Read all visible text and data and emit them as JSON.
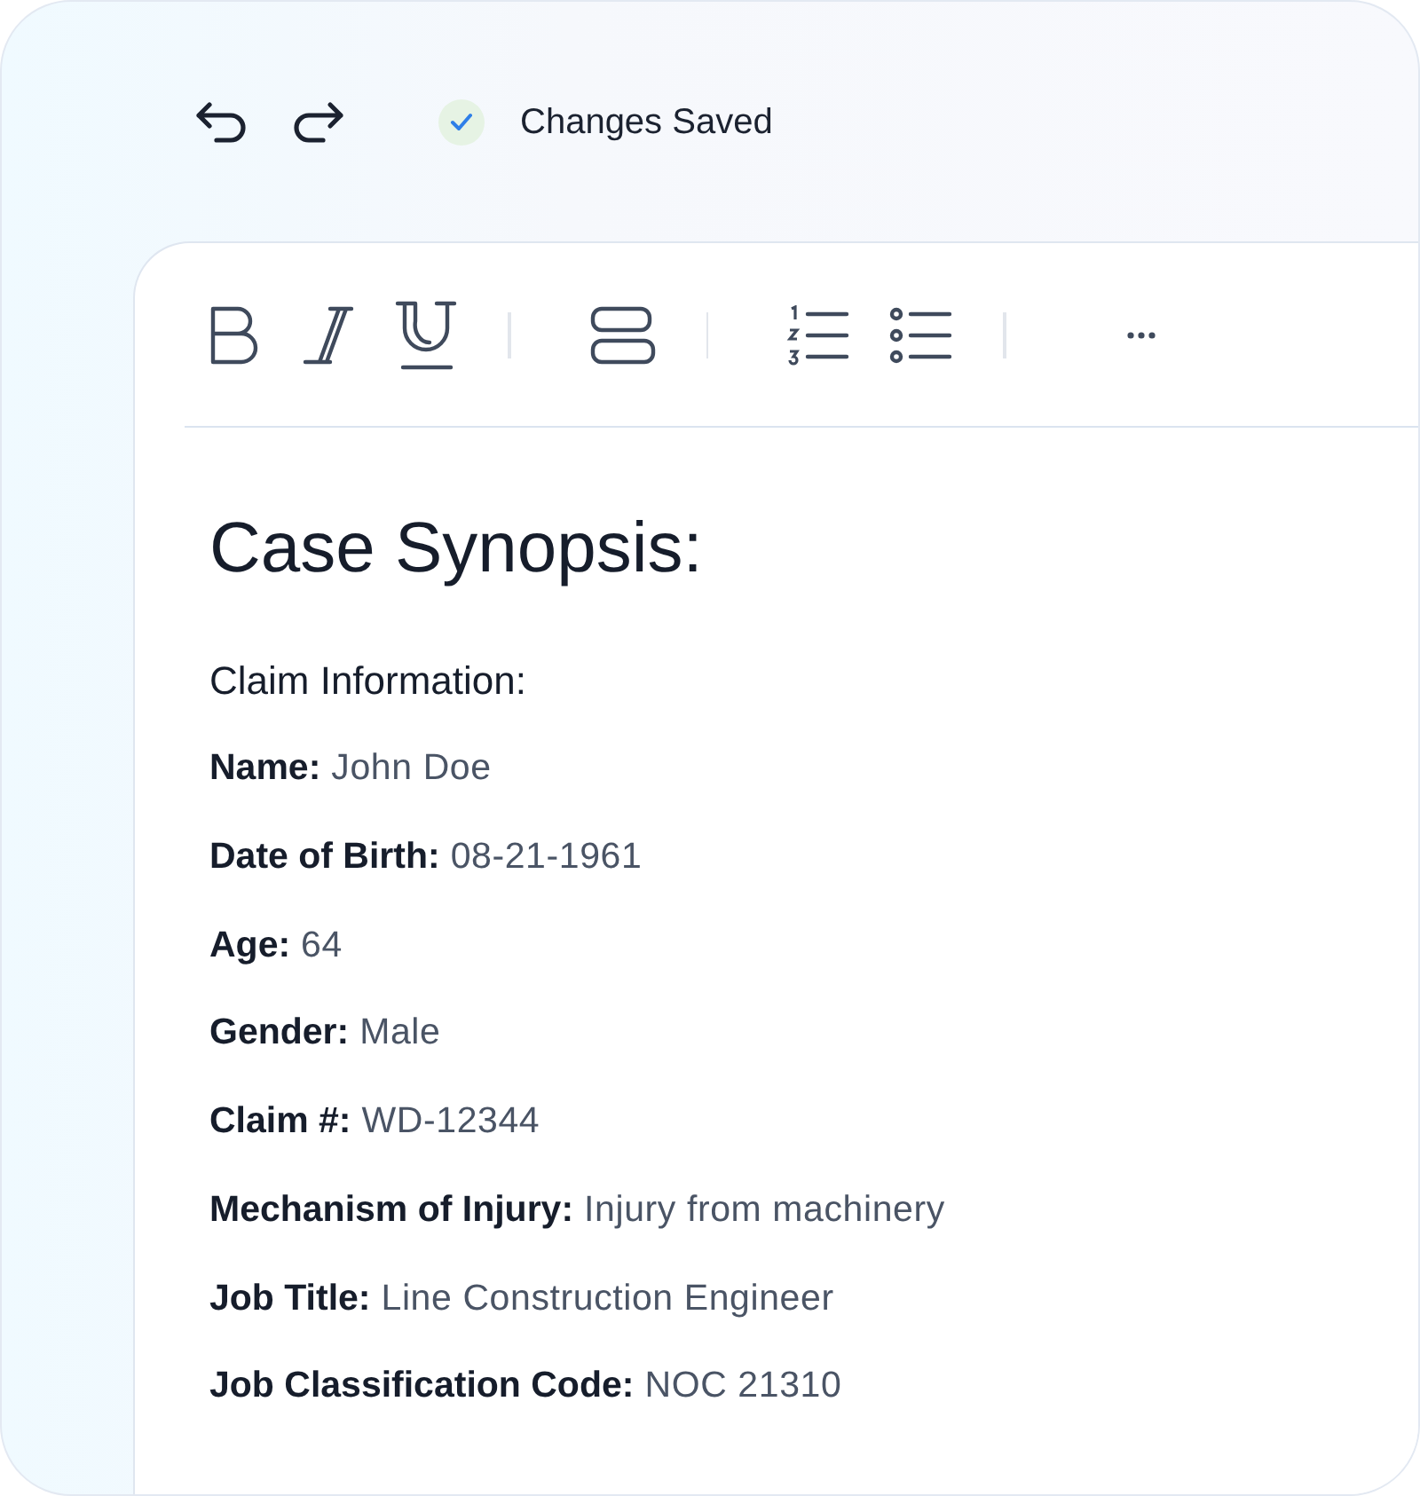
{
  "header": {
    "actions": [
      {
        "kind": "undo"
      },
      {
        "kind": "redo"
      }
    ],
    "status": {
      "saved": true,
      "text": "Changes Saved"
    }
  },
  "toolbar": [
    {
      "kind": "bold"
    },
    {
      "kind": "italic"
    },
    {
      "kind": "underline"
    },
    {
      "kind": "divider"
    },
    {
      "kind": "block"
    },
    {
      "kind": "divider"
    },
    {
      "kind": "ordered-list"
    },
    {
      "kind": "bullet-list"
    },
    {
      "kind": "divider"
    },
    {
      "kind": "more"
    }
  ],
  "document": {
    "title": "Case Synopsis:",
    "section": "Claim Information:",
    "fields": [
      {
        "label": "Name:",
        "value": "John Doe"
      },
      {
        "label": "Date of Birth:",
        "value": "08-21-1961"
      },
      {
        "label": "Age:",
        "value": "64"
      },
      {
        "label": "Gender:",
        "value": "Male"
      },
      {
        "label": "Claim #:",
        "value": "WD-12344"
      },
      {
        "label": "Mechanism of Injury:",
        "value": "Injury from machinery"
      },
      {
        "label": "Job Title:",
        "value": "Line Construction Engineer"
      },
      {
        "label": "Job Classification Code:",
        "value": "NOC 21310"
      }
    ]
  }
}
